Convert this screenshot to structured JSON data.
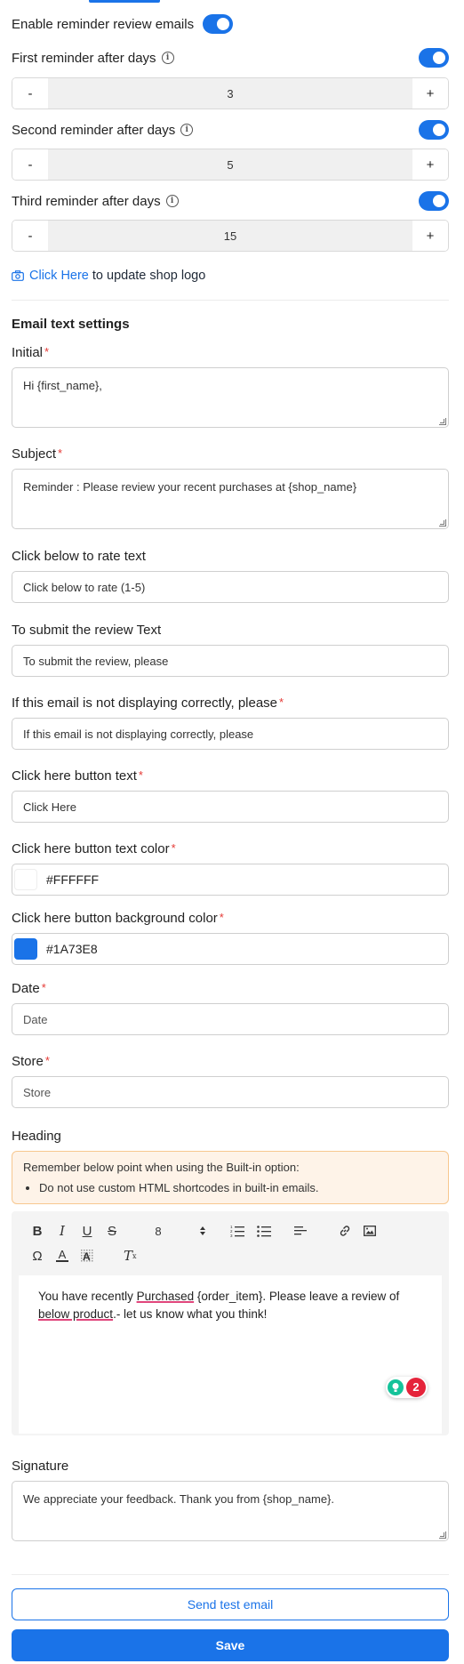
{
  "reminders": {
    "enable_label": "Enable reminder review emails",
    "first": {
      "label": "First reminder after days",
      "value": "3",
      "enabled": true
    },
    "second": {
      "label": "Second reminder after days",
      "value": "5",
      "enabled": true
    },
    "third": {
      "label": "Third reminder after days",
      "value": "15",
      "enabled": true
    },
    "minus": "-",
    "plus": "+",
    "info_glyph": "i"
  },
  "logo": {
    "link": "Click Here",
    "text": " to update shop logo"
  },
  "email_settings": {
    "title": "Email text settings",
    "required_mark": "*",
    "initial": {
      "label": "Initial",
      "value": "Hi {first_name},"
    },
    "subject": {
      "label": "Subject",
      "value": "Reminder : Please review your recent purchases at {shop_name}"
    },
    "rate_text": {
      "label": "Click below to rate text",
      "value": "Click below to rate (1-5)"
    },
    "submit_text": {
      "label": "To submit the review Text",
      "value": "To submit the review, please"
    },
    "not_displaying": {
      "label": "If this email is not displaying correctly, please",
      "value": "If this email is not displaying correctly, please"
    },
    "button_text": {
      "label": "Click here button text",
      "value": "Click Here"
    },
    "button_text_color": {
      "label": "Click here button text color",
      "value": "#FFFFFF"
    },
    "button_bg_color": {
      "label": "Click here button background color",
      "value": "#1A73E8"
    },
    "date": {
      "label": "Date",
      "placeholder": "Date"
    },
    "store": {
      "label": "Store",
      "placeholder": "Store"
    },
    "heading": {
      "label": "Heading"
    }
  },
  "notice": {
    "title": "Remember below point when using the Built-in option:",
    "items": [
      "Do not use custom HTML shortcodes in built-in emails."
    ]
  },
  "editor": {
    "font_size": "8",
    "body_part1": "You have recently ",
    "body_word1": "Purchased",
    "body_part2": " {order_item}. Please leave a review of ",
    "body_word2": "below product",
    "body_part3": ".- let us know what you think!",
    "grammarly_count": "2"
  },
  "signature": {
    "label": "Signature",
    "value": "We appreciate your feedback. Thank you from {shop_name}."
  },
  "actions": {
    "test": "Send test email",
    "save": "Save"
  },
  "colors": {
    "accent": "#1A73E8",
    "required": "#e53935",
    "notice_bg": "#fef3e8"
  }
}
